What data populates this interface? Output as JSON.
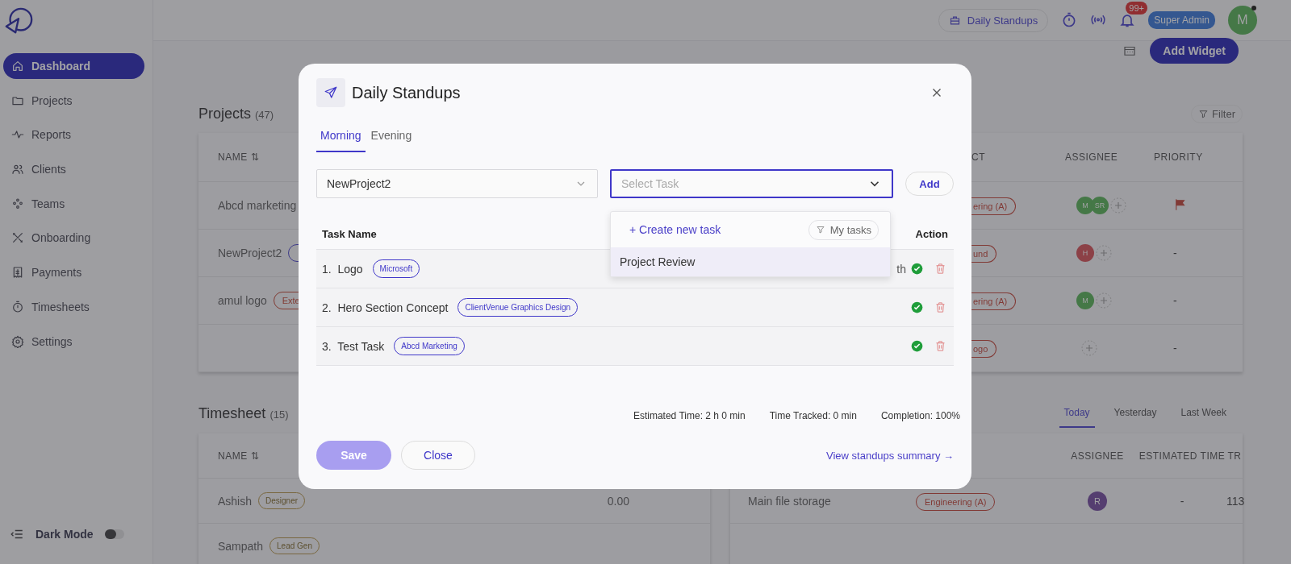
{
  "sidebar": {
    "nav": [
      {
        "label": "Dashboard",
        "selected": true
      },
      {
        "label": "Projects",
        "selected": false
      },
      {
        "label": "Reports",
        "selected": false
      },
      {
        "label": "Clients",
        "selected": false
      },
      {
        "label": "Teams",
        "selected": false
      },
      {
        "label": "Onboarding",
        "selected": false
      },
      {
        "label": "Payments",
        "selected": false
      },
      {
        "label": "Timesheets",
        "selected": false
      },
      {
        "label": "Settings",
        "selected": false
      }
    ],
    "dark_mode": {
      "label": "Dark Mode",
      "on": false
    }
  },
  "header": {
    "standups_button": "Daily Standups",
    "notification_badge": "99+",
    "role_badge": "Super Admin",
    "avatar": {
      "initial": "M",
      "color": "#457847"
    }
  },
  "toolbar": {
    "add_widget_button": "Add Widget"
  },
  "projects": {
    "title": "Projects",
    "count": "(47)",
    "filter_button": "Filter",
    "columns": [
      "NAME ⇅",
      "CT",
      "ASSIGNEE",
      "PRIORITY"
    ],
    "rows": [
      {
        "name": "Abcd marketing",
        "project_tag": "ering (A)",
        "assignees": [
          {
            "initial": "M",
            "color": "#457847"
          },
          {
            "initial": "SR",
            "color": "#457847"
          }
        ],
        "priority": {
          "kind": "flag"
        }
      },
      {
        "name": "NewProject2",
        "name_tag": {
          "color": "#3e3a88"
        },
        "project_tag": "und",
        "assignees": [
          {
            "initial": "H",
            "color": "#8c4147"
          }
        ],
        "priority": {
          "kind": "text",
          "text": "-"
        }
      },
      {
        "name": "amul logo",
        "name_tag": {
          "text": "Exte",
          "color": "#813b33"
        },
        "project_tag": "ering (A)",
        "assignees": [
          {
            "initial": "M",
            "color": "#457847"
          }
        ],
        "priority": {
          "kind": "text",
          "text": "-"
        }
      },
      {
        "project_tag": "ogo",
        "assignees": [],
        "priority": {
          "kind": "text",
          "text": "-"
        }
      }
    ]
  },
  "timesheet": {
    "title": "Timesheet",
    "count": "(15)",
    "tabs": [
      {
        "label": "Today",
        "selected": true
      },
      {
        "label": "Yesterday",
        "selected": false
      },
      {
        "label": "Last Week",
        "selected": false
      }
    ],
    "left_table": {
      "columns": [
        "NAME ⇅"
      ],
      "rows": [
        {
          "name": "Ashish",
          "tag": "Designer",
          "value": "0.00"
        },
        {
          "name": "Sampath",
          "tag": "Lead Gen"
        }
      ]
    },
    "right_table": {
      "columns": [
        "ASSIGNEE",
        "ESTIMATED TIME",
        "TR"
      ],
      "rows": [
        {
          "name": "Main file storage",
          "tag": "Engineering (A)",
          "assignee": {
            "initial": "R",
            "color": "#553e70"
          },
          "estimated": "-",
          "tracked": "113"
        }
      ]
    }
  },
  "modal": {
    "title": "Daily Standups",
    "tabs": [
      {
        "label": "Morning",
        "selected": true
      },
      {
        "label": "Evening",
        "selected": false
      }
    ],
    "project_select": {
      "value": "NewProject2"
    },
    "task_select": {
      "placeholder": "Select Task",
      "focused": true
    },
    "add_button": "Add",
    "dropdown": {
      "create_link": "+ Create new task",
      "filter_chip": "My tasks",
      "options": [
        {
          "label": "Project Review",
          "highlighted": true
        }
      ]
    },
    "table": {
      "columns": [
        "Task Name",
        "Action"
      ],
      "rows": [
        {
          "number": "1.",
          "name": "Logo",
          "tag": "Microsoft",
          "extra": "th",
          "done": true
        },
        {
          "number": "2.",
          "name": "Hero Section Concept",
          "tag": "ClientVenue Graphics Design",
          "done": true
        },
        {
          "number": "3.",
          "name": "Test Task",
          "tag": "Abcd Marketing",
          "done": true
        }
      ]
    },
    "stats": [
      "Estimated Time: 2 h 0 min",
      "Time Tracked: 0 min",
      "Completion: 100%"
    ],
    "save_button": {
      "label": "Save",
      "disabled": true
    },
    "close_button": "Close",
    "summary_link": "View standups summary →"
  }
}
